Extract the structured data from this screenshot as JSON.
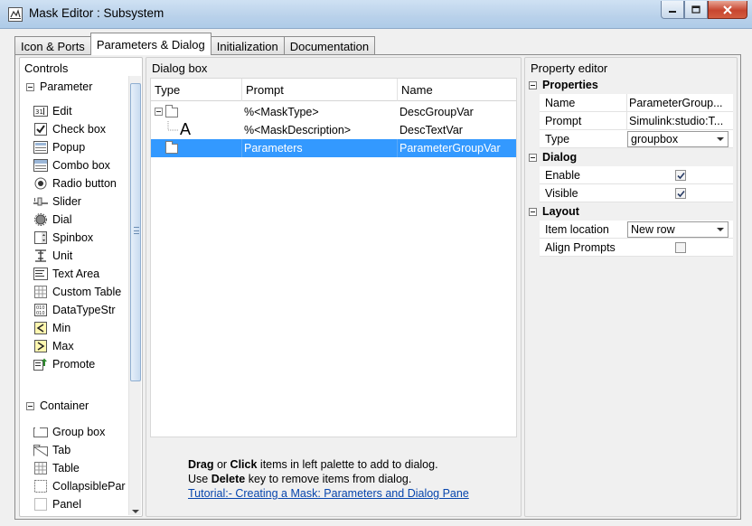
{
  "window": {
    "title": "Mask Editor : Subsystem"
  },
  "tabs": [
    "Icon & Ports",
    "Parameters & Dialog",
    "Initialization",
    "Documentation"
  ],
  "controls": {
    "title": "Controls",
    "parameter_section": "Parameter",
    "parameters": [
      {
        "label": "Edit",
        "icon": "edit-icon"
      },
      {
        "label": "Check box",
        "icon": "checkbox-icon"
      },
      {
        "label": "Popup",
        "icon": "popup-icon"
      },
      {
        "label": "Combo box",
        "icon": "combobox-icon"
      },
      {
        "label": "Radio button",
        "icon": "radio-icon"
      },
      {
        "label": "Slider",
        "icon": "slider-icon"
      },
      {
        "label": "Dial",
        "icon": "dial-icon"
      },
      {
        "label": "Spinbox",
        "icon": "spinbox-icon"
      },
      {
        "label": "Unit",
        "icon": "unit-icon"
      },
      {
        "label": "Text Area",
        "icon": "textarea-icon"
      },
      {
        "label": "Custom Table",
        "icon": "table-icon"
      },
      {
        "label": "DataTypeStr",
        "icon": "datatype-icon"
      },
      {
        "label": "Min",
        "icon": "min-icon"
      },
      {
        "label": "Max",
        "icon": "max-icon"
      },
      {
        "label": "Promote",
        "icon": "promote-icon"
      }
    ],
    "container_section": "Container",
    "containers": [
      {
        "label": "Group box",
        "icon": "groupbox-icon"
      },
      {
        "label": "Tab",
        "icon": "tab-icon"
      },
      {
        "label": "Table",
        "icon": "table-icon"
      },
      {
        "label": "CollapsiblePar",
        "icon": "collapsible-icon"
      },
      {
        "label": "Panel",
        "icon": "panel-icon"
      }
    ]
  },
  "dialog_box": {
    "title": "Dialog box",
    "columns": [
      "Type",
      "Prompt",
      "Name"
    ],
    "rows": [
      {
        "prompt": "%<MaskType>",
        "name": "DescGroupVar",
        "icon": "folder-icon"
      },
      {
        "prompt": "%<MaskDescription>",
        "name": "DescTextVar",
        "icon": "text-a-icon",
        "type_glyph": "A"
      },
      {
        "prompt": "Parameters",
        "name": "ParameterGroupVar",
        "icon": "folder-icon",
        "selected": true
      }
    ],
    "instructions": {
      "line1_b1": "Drag",
      "line1_t1": " or ",
      "line1_b2": "Click",
      "line1_t2": " items in left palette to add to dialog.",
      "line2_t1": "Use ",
      "line2_b1": "Delete",
      "line2_t2": " key to remove items from dialog.",
      "link": "Tutorial:- Creating a Mask: Parameters and Dialog Pane"
    }
  },
  "property_editor": {
    "title": "Property editor",
    "groups": {
      "properties": "Properties",
      "dialog": "Dialog",
      "layout": "Layout"
    },
    "properties": {
      "name_label": "Name",
      "name_value": "ParameterGroup...",
      "prompt_label": "Prompt",
      "prompt_value": "Simulink:studio:T...",
      "type_label": "Type",
      "type_value": "groupbox"
    },
    "dialog": {
      "enable_label": "Enable",
      "enable_checked": true,
      "visible_label": "Visible",
      "visible_checked": true
    },
    "layout": {
      "item_location_label": "Item location",
      "item_location_value": "New row",
      "align_prompts_label": "Align Prompts",
      "align_prompts_checked": false
    }
  }
}
